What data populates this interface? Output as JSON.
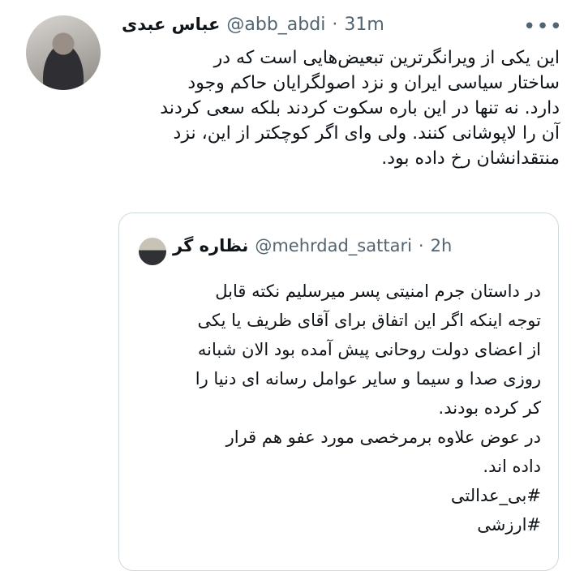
{
  "tweet": {
    "author_name": "عباس عبدی",
    "handle": "@abb_abdi",
    "separator": "·",
    "time": "31m",
    "more_icon": "more-dots-icon",
    "lines": [
      "این یکی از ویرانگرترین تبعیض‌هایی است که در",
      "ساختار سیاسی ایران و نزد اصولگرایان حاکم وجود",
      "دارد. نه تنها در این باره سکوت کردند بلکه سعی کردند",
      "آن را لاپوشانی کنند. ولی وای اگر کوچکتر از این، نزد",
      "منتقدانشان رخ داده بود."
    ]
  },
  "quoted": {
    "author_name": "نظاره گر",
    "handle": "@mehrdad_sattari",
    "separator": "·",
    "time": "2h",
    "lines": [
      "در داستان جرم امنیتی پسر میرسلیم نکته قابل",
      "توجه اینکه اگر این اتفاق برای آقای ظریف یا یکی",
      "از اعضای دولت روحانی پیش آمده بود الان شبانه",
      "روزی صدا و سیما و سایر عوامل رسانه ای دنیا را",
      "کر کرده بودند.",
      " در عوض علاوه برمرخصی مورد عفو هم قرار",
      "داده اند.",
      "#بی_عدالتی",
      "#ارزشی"
    ]
  }
}
